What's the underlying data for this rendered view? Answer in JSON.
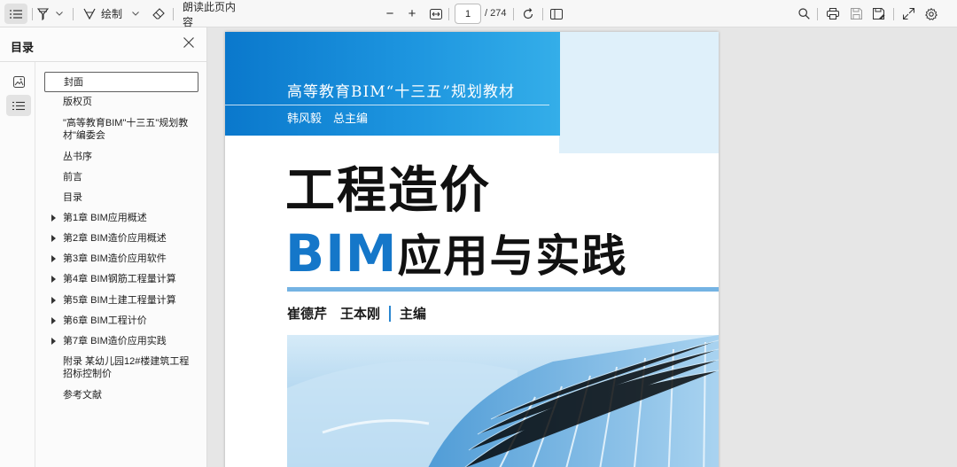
{
  "toolbar": {
    "contents_icon": "list-icon",
    "highlight_icon": "highlighter-icon",
    "draw_label": "绘制",
    "erase_icon": "eraser-icon",
    "read_aloud_label": "朗读此页内容",
    "zoom_out": "−",
    "zoom_in": "+",
    "current_page": "1",
    "total_pages": "/ 274",
    "colors": {
      "accent": "#0a78cc"
    }
  },
  "sidebar": {
    "title": "目录",
    "toc": [
      {
        "label": "封面",
        "expandable": false,
        "selected": true
      },
      {
        "label": "版权页",
        "expandable": false
      },
      {
        "label": "\"高等教育BIM\"十三五\"规划教",
        "label2": "材\"编委会",
        "expandable": false
      },
      {
        "label": "丛书序",
        "expandable": false
      },
      {
        "label": "前言",
        "expandable": false
      },
      {
        "label": "目录",
        "expandable": false
      },
      {
        "label": "第1章 BIM应用概述",
        "expandable": true
      },
      {
        "label": "第2章 BIM造价应用概述",
        "expandable": true
      },
      {
        "label": "第3章 BIM造价应用软件",
        "expandable": true
      },
      {
        "label": "第4章 BIM钢筋工程量计算",
        "expandable": true
      },
      {
        "label": "第5章 BIM土建工程量计算",
        "expandable": true
      },
      {
        "label": "第6章 BIM工程计价",
        "expandable": true
      },
      {
        "label": "第7章 BIM造价应用实践",
        "expandable": true
      },
      {
        "label": "附录 某幼儿园12#楼建筑工程",
        "label2": "招标控制价",
        "expandable": false
      },
      {
        "label": "参考文献",
        "expandable": false
      }
    ]
  },
  "cover": {
    "series_title": "高等教育BIM“十三五”规划教材",
    "chief_editor": "韩风毅　总主编",
    "title_line1": "工程造价",
    "title_line2_bim": "BIM",
    "title_line2_rest": "应用与实践",
    "authors": "崔德芹　王本刚",
    "editor_role": "主编",
    "colors": {
      "band": "#0a78cc",
      "title_bim": "#1577c9"
    }
  }
}
